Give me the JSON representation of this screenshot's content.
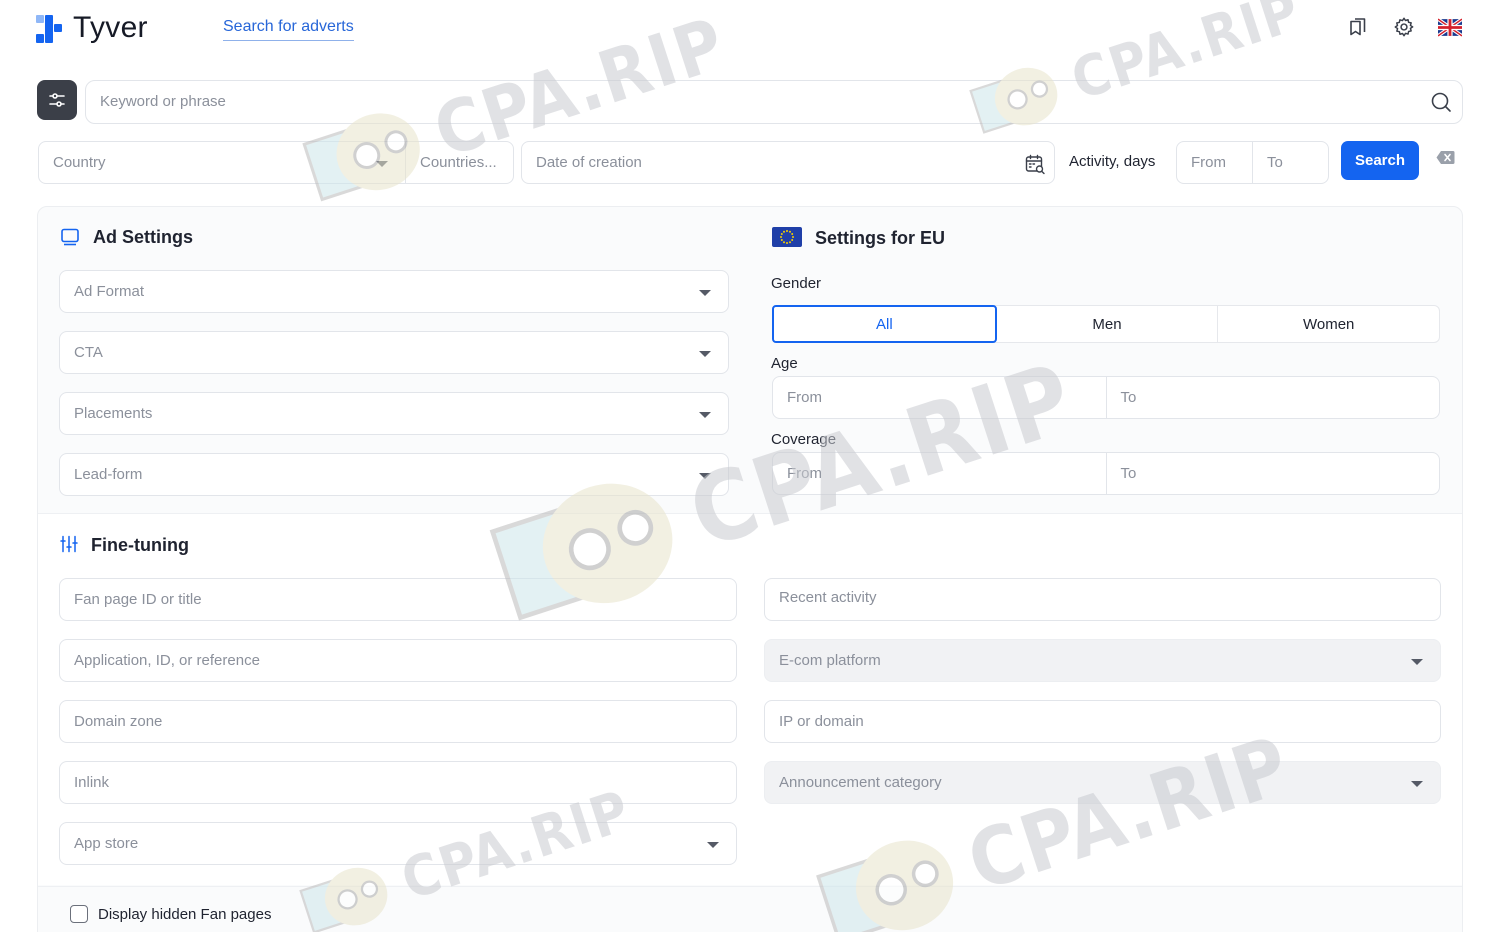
{
  "header": {
    "logo_text": "Tyver",
    "nav_link": "Search for adverts",
    "icons": [
      "bookmarks-icon",
      "gear-icon",
      "uk-flag-icon"
    ]
  },
  "search": {
    "keyword_placeholder": "Keyword or phrase",
    "country_placeholder": "Country",
    "countries_placeholder": "Countries...",
    "date_placeholder": "Date of creation",
    "activity_label": "Activity, days",
    "activity_from": "From",
    "activity_to": "To",
    "search_button": "Search"
  },
  "ad_settings": {
    "title": "Ad Settings",
    "fields": [
      "Ad Format",
      "CTA",
      "Placements",
      "Lead-form"
    ]
  },
  "eu_settings": {
    "title": "Settings for EU",
    "gender_label": "Gender",
    "gender_options": [
      "All",
      "Men",
      "Women"
    ],
    "gender_selected": "All",
    "age_label": "Age",
    "age_from": "From",
    "age_to": "To",
    "coverage_label": "Coverage",
    "coverage_from": "From",
    "coverage_to": "To"
  },
  "fine_tuning": {
    "title": "Fine-tuning",
    "left_fields": [
      "Fan page ID or title",
      "Application, ID, or reference",
      "Domain zone",
      "Inlink",
      "App store"
    ],
    "right_fields": [
      "Recent activity",
      "E-com platform",
      "IP or domain",
      "Announcement category"
    ]
  },
  "footer": {
    "hidden_fanpages_label": "Display hidden Fan pages"
  },
  "watermark": "CPA.RIP",
  "colors": {
    "accent": "#1464f0",
    "filter_button": "#3b3f48",
    "placeholder": "#8b909b"
  }
}
